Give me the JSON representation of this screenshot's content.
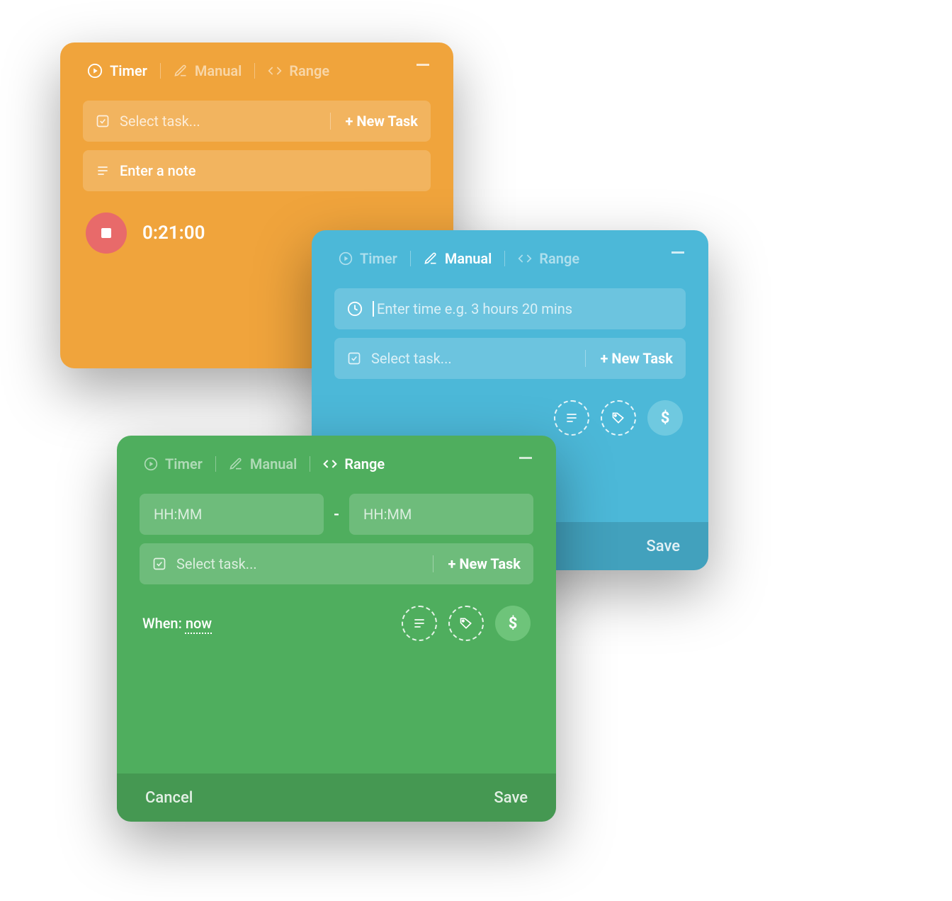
{
  "tabs": {
    "timer": "Timer",
    "manual": "Manual",
    "range": "Range"
  },
  "common": {
    "selectTask": "Select task...",
    "newTask": "+ New Task",
    "cancel": "Cancel",
    "save": "Save"
  },
  "orange": {
    "notePlaceholder": "Enter a note",
    "elapsed": "0:21:00"
  },
  "blue": {
    "timePlaceholder": "Enter time e.g. 3 hours 20 mins"
  },
  "green": {
    "hhmm": "HH:MM",
    "whenLabel": "When: ",
    "whenValue": "now"
  },
  "colors": {
    "orange": "#f0a43c",
    "blue": "#4cb8d8",
    "green": "#4fae5e",
    "stop": "#e86a6a"
  }
}
